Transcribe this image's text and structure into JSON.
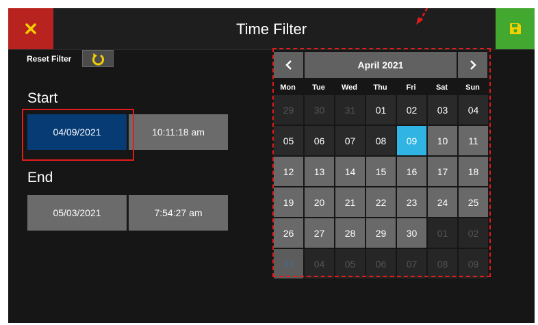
{
  "header": {
    "title": "Time Filter",
    "close_icon": "close-icon",
    "save_icon": "save-disk-icon"
  },
  "reset": {
    "label": "Reset Filter",
    "icon": "reset-rotate-icon"
  },
  "start": {
    "label": "Start",
    "date": "04/09/2021",
    "time": "10:11:18 am"
  },
  "end": {
    "label": "End",
    "date": "05/03/2021",
    "time": "7:54:27 am"
  },
  "calendar": {
    "month_label": "April 2021",
    "prev_icon": "chevron-left-icon",
    "next_icon": "chevron-right-icon",
    "weekdays": [
      "Mon",
      "Tue",
      "Wed",
      "Thu",
      "Fri",
      "Sat",
      "Sun"
    ],
    "weeks": [
      [
        "29",
        "30",
        "31",
        "01",
        "02",
        "03",
        "04"
      ],
      [
        "05",
        "06",
        "07",
        "08",
        "09",
        "10",
        "11"
      ],
      [
        "12",
        "13",
        "14",
        "15",
        "16",
        "17",
        "18"
      ],
      [
        "19",
        "20",
        "21",
        "22",
        "23",
        "24",
        "25"
      ],
      [
        "26",
        "27",
        "28",
        "29",
        "30",
        "01",
        "02"
      ],
      [
        "03",
        "04",
        "05",
        "06",
        "07",
        "08",
        "09"
      ]
    ],
    "selected_day": "09"
  },
  "colors": {
    "close": "#b8231f",
    "save": "#43a82f",
    "selected_field": "#063b74",
    "selected_day": "#2fb4e3",
    "annotation": "#e21b1b"
  }
}
